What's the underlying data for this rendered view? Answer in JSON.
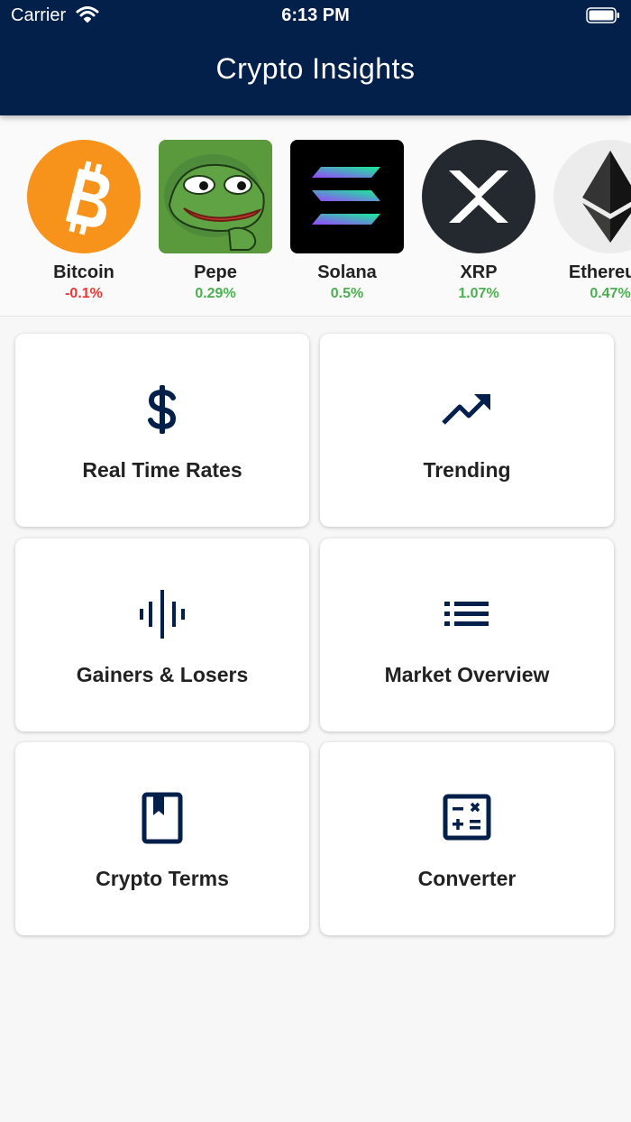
{
  "status_bar": {
    "carrier": "Carrier",
    "time": "6:13 PM"
  },
  "header": {
    "title": "Crypto Insights"
  },
  "colors": {
    "header_bg": "#03204a",
    "positive": "#4caf50",
    "negative": "#e53935",
    "icon": "#03204a"
  },
  "coins": [
    {
      "name": "Bitcoin",
      "change": "-0.1%",
      "trend": "negative",
      "icon": "bitcoin-logo"
    },
    {
      "name": "Pepe",
      "change": "0.29%",
      "trend": "positive",
      "icon": "pepe-logo"
    },
    {
      "name": "Solana",
      "change": "0.5%",
      "trend": "positive",
      "icon": "solana-logo"
    },
    {
      "name": "XRP",
      "change": "1.07%",
      "trend": "positive",
      "icon": "xrp-logo"
    },
    {
      "name": "Ethereum",
      "change": "0.47%",
      "trend": "positive",
      "icon": "ethereum-logo"
    }
  ],
  "menu": [
    {
      "label": "Real Time Rates",
      "icon": "dollar-icon"
    },
    {
      "label": "Trending",
      "icon": "trending-up-icon"
    },
    {
      "label": "Gainers & Losers",
      "icon": "waveform-icon"
    },
    {
      "label": "Market Overview",
      "icon": "list-icon"
    },
    {
      "label": "Crypto Terms",
      "icon": "book-icon"
    },
    {
      "label": "Converter",
      "icon": "calculator-icon"
    }
  ]
}
